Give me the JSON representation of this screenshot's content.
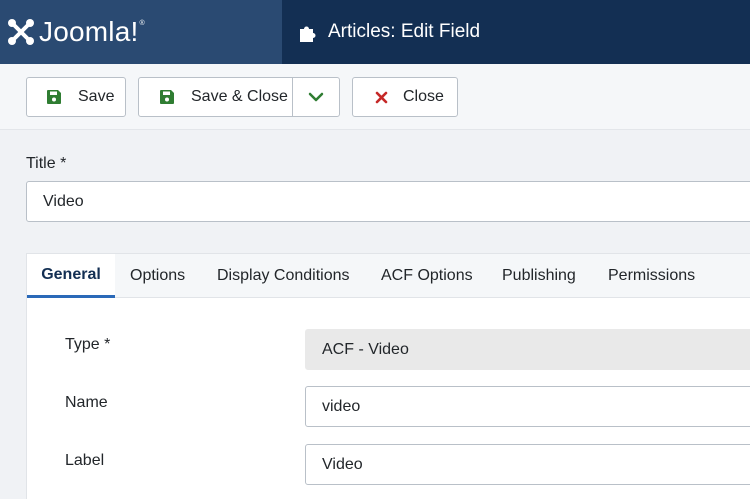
{
  "header": {
    "logo_text": "Joomla!",
    "logo_reg": "®",
    "page_icon": "puzzle-icon",
    "page_title": "Articles: Edit Field"
  },
  "toolbar": {
    "save_label": "Save",
    "save_icon": "save-icon",
    "save_close_label": "Save & Close",
    "dropdown_icon": "chevron-down-icon",
    "close_label": "Close",
    "close_icon": "close-icon",
    "save_color": "#2f7d32",
    "close_color": "#c52827"
  },
  "form": {
    "title_label": "Title *",
    "title_value": "Video"
  },
  "tabs": [
    {
      "label": "General",
      "active": true
    },
    {
      "label": "Options",
      "active": false
    },
    {
      "label": "Display Conditions",
      "active": false
    },
    {
      "label": "ACF Options",
      "active": false
    },
    {
      "label": "Publishing",
      "active": false
    },
    {
      "label": "Permissions",
      "active": false
    }
  ],
  "fields": [
    {
      "label": "Type *",
      "value": "ACF - Video"
    },
    {
      "label": "Name",
      "value": "video"
    },
    {
      "label": "Label",
      "value": "Video"
    }
  ],
  "colors": {
    "header_bg": "#132f53",
    "logo_bg": "#2a4a72",
    "tab_accent": "#2a69b8"
  }
}
